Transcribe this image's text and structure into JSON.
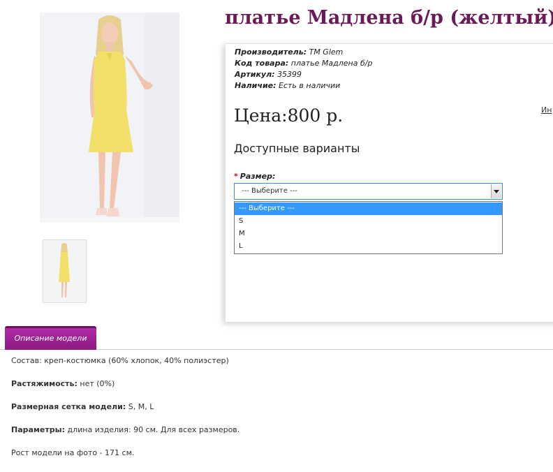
{
  "product": {
    "title": "платье Мадлена б/р (желтый)",
    "specs": [
      {
        "label": "Производитель:",
        "value": "TM Glem"
      },
      {
        "label": "Код товара:",
        "value": "платье Мадлена б/р"
      },
      {
        "label": "Артикул:",
        "value": "35399"
      },
      {
        "label": "Наличие:",
        "value": "Есть в наличии"
      }
    ],
    "price": "Цена:800 р.",
    "edge_link": "Ин",
    "variants_heading": "Доступные варианты",
    "size_label": "Размер:",
    "size_required_mark": "*",
    "size_selected": "--- Выберите ---",
    "size_options": [
      "--- Выберите ---",
      "S",
      "M",
      "L"
    ]
  },
  "tab": {
    "label": "Описание модели"
  },
  "description": [
    {
      "label": "",
      "text": "Состав: креп-костюмка (60% хлопок, 40% полиэстер)"
    },
    {
      "label": "Растяжимость:",
      "text": " нет (0%)"
    },
    {
      "label": "Размерная сетка модели:",
      "text": " S, M, L"
    },
    {
      "label": "Параметры:",
      "text": " длина изделия: 90 см. Для всех размеров."
    },
    {
      "label": "",
      "text": "Рост модели на фото - 171 см."
    }
  ],
  "colors": {
    "title": "#6b1a55",
    "tab": "#a0259a",
    "dress": "#f2e06a",
    "selected_option": "#3399ff"
  }
}
